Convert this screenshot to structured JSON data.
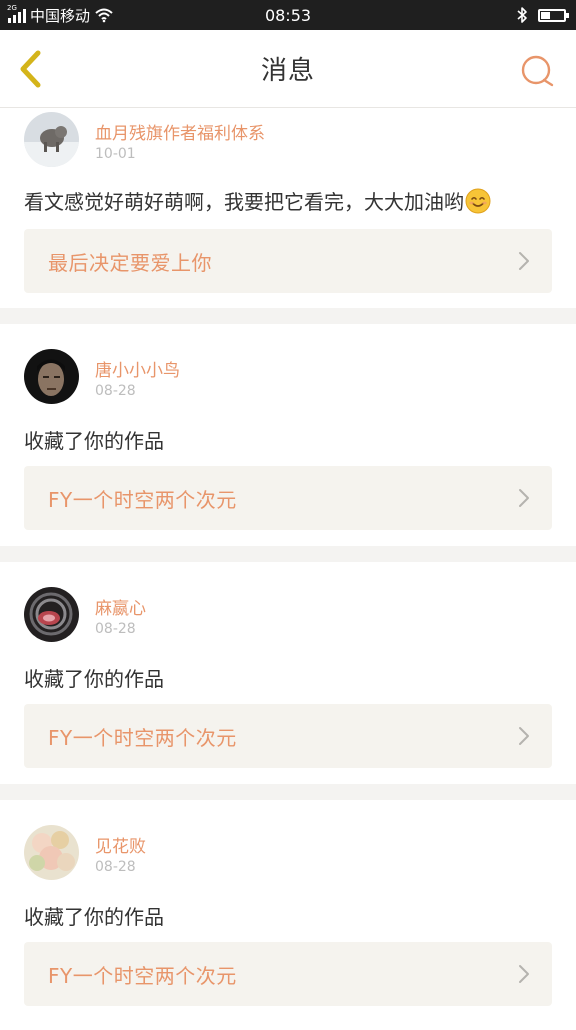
{
  "status_bar": {
    "network": "2G",
    "carrier": "中国移动",
    "time": "08:53",
    "battery_level": 0.4
  },
  "header": {
    "title": "消息"
  },
  "colors": {
    "accent": "#e8956a",
    "back_arrow": "#d4b41a",
    "card_link_bg": "#f5f3ee"
  },
  "messages": [
    {
      "username": "血月残旗作者福利体系",
      "date": "10-01",
      "text": "看文感觉好萌好萌啊，我要把它看完，大大加油哟",
      "emoji": "smiling-face",
      "work_title": "最后决定要爱上你"
    },
    {
      "username": "唐小小小鸟",
      "date": "08-28",
      "text": "收藏了你的作品",
      "work_title": "FY一个时空两个次元"
    },
    {
      "username": "麻嬴心",
      "date": "08-28",
      "text": "收藏了你的作品",
      "work_title": "FY一个时空两个次元"
    },
    {
      "username": "见花败",
      "date": "08-28",
      "text": "收藏了你的作品",
      "work_title": "FY一个时空两个次元"
    }
  ]
}
